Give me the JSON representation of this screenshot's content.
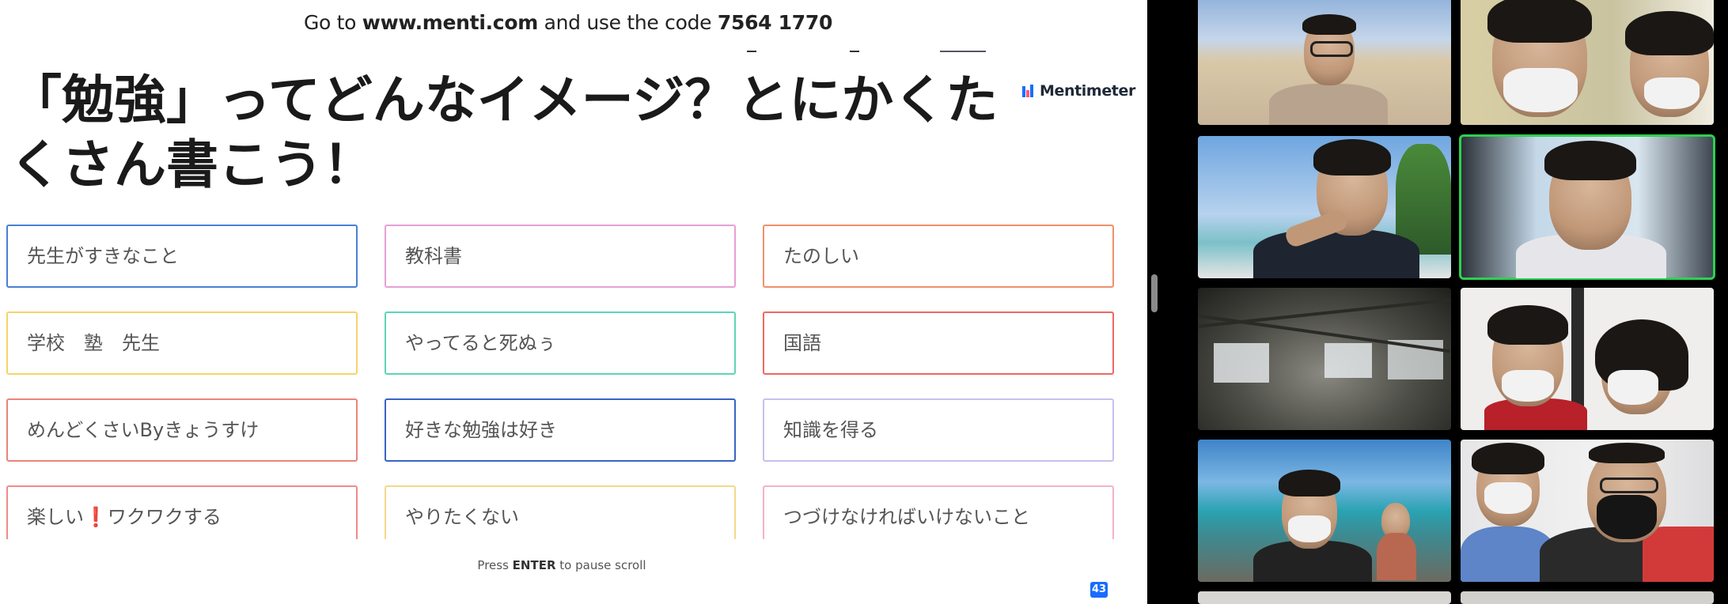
{
  "join_bar": {
    "prefix": "Go to ",
    "url": "www.menti.com",
    "middle": " and use the code ",
    "code": "7564 1770"
  },
  "brand": {
    "name": "Mentimeter",
    "logo_icon": "mentimeter-logo-icon"
  },
  "question": "「勉強」ってどんなイメージ？とにかくたくさん書こう！",
  "responses": [
    {
      "text": "先生がすきなこと",
      "color": "#4a7fd6"
    },
    {
      "text": "教科書",
      "color": "#e6a0d4"
    },
    {
      "text": "たのしい",
      "color": "#f0906a"
    },
    {
      "text": "学校　塾　先生",
      "color": "#f6d36a"
    },
    {
      "text": "やってると死ぬぅ",
      "color": "#5fd4b8"
    },
    {
      "text": "国語",
      "color": "#ea6a63"
    },
    {
      "text": "めんどくさいByきょうすけ",
      "color": "#e9857a"
    },
    {
      "text": "好きな勉強は好き",
      "color": "#3a63c4"
    },
    {
      "text": "知識を得る",
      "color": "#c7c0ef"
    },
    {
      "text": "楽しい",
      "text_after": "ワクワクする",
      "emoji": "❗",
      "color": "#f08a8a"
    },
    {
      "text": "やりたくない",
      "color": "#f4d88a"
    },
    {
      "text": "つづけなければいけないこと",
      "color": "#f3b3c5"
    }
  ],
  "pause_hint": {
    "prefix": "Press ",
    "key": "ENTER",
    "suffix": " to pause scroll"
  },
  "response_count": "43",
  "colors": {
    "accent": "#196cff",
    "active_speaker": "#2cd14f"
  }
}
